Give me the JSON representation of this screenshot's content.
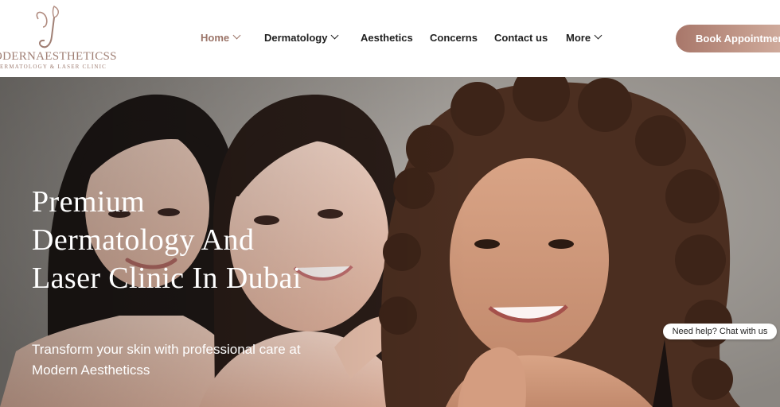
{
  "brand": {
    "name": "ODERNAESTHETICSS",
    "tagline": "ERMATOLOGY & LASER CLINIC",
    "accent_color": "#9b7468"
  },
  "nav": {
    "items": [
      {
        "label": "Home",
        "has_dropdown": true,
        "active": true
      },
      {
        "label": "Dermatology",
        "has_dropdown": true,
        "active": false
      },
      {
        "label": "Aesthetics",
        "has_dropdown": false,
        "active": false
      },
      {
        "label": "Concerns",
        "has_dropdown": false,
        "active": false
      },
      {
        "label": "Contact us",
        "has_dropdown": false,
        "active": false
      },
      {
        "label": "More",
        "has_dropdown": true,
        "active": false
      }
    ],
    "cta_label": "Book Appointment"
  },
  "hero": {
    "title_lines": [
      "Premium",
      "Dermatology And",
      "Laser Clinic In Dubai"
    ],
    "subtitle_lines": [
      "Transform your skin with professional care at",
      "Modern Aestheticss"
    ]
  },
  "chat": {
    "label": "Need help? Chat with us"
  }
}
